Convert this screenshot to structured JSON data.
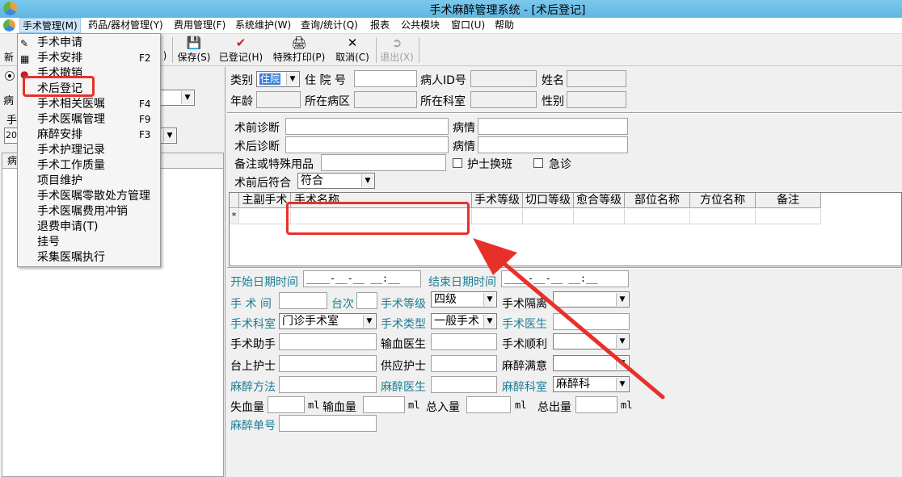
{
  "window": {
    "title": "手术麻醉管理系统 - [术后登记]"
  },
  "menubar": [
    {
      "label": "手术管理(M)"
    },
    {
      "label": "药品/器材管理(Y)"
    },
    {
      "label": "费用管理(F)"
    },
    {
      "label": "系统维护(W)"
    },
    {
      "label": "查询/统计(Q)"
    },
    {
      "label": "报表"
    },
    {
      "label": "公共模块"
    },
    {
      "label": "窗口(U)"
    },
    {
      "label": "帮助"
    }
  ],
  "toolbar": {
    "new_label": "新",
    "partial_label": ")",
    "save_label": "保存(S)",
    "registered_label": "已登记(H)",
    "special_print_label": "特殊打印(P)",
    "cancel_label": "取消(C)",
    "exit_label": "退出(X)"
  },
  "dropdown": [
    {
      "label": "手术申请",
      "shortcut": ""
    },
    {
      "label": "手术安排",
      "shortcut": "F2"
    },
    {
      "label": "手术撤销",
      "shortcut": ""
    },
    {
      "label": "术后登记",
      "shortcut": ""
    },
    {
      "label": "手术相关医嘱",
      "shortcut": "F4"
    },
    {
      "label": "手术医嘱管理",
      "shortcut": "F9"
    },
    {
      "label": "麻醉安排",
      "shortcut": "F3"
    },
    {
      "label": "手术护理记录",
      "shortcut": ""
    },
    {
      "label": "手术工作质量",
      "shortcut": ""
    },
    {
      "label": "项目维护",
      "shortcut": ""
    },
    {
      "label": "手术医嘱零散处方管理",
      "shortcut": ""
    },
    {
      "label": "手术医嘱费用冲销",
      "shortcut": ""
    },
    {
      "label": "退费申请(T)",
      "shortcut": ""
    },
    {
      "label": "挂号",
      "shortcut": ""
    },
    {
      "label": "采集医嘱执行",
      "shortcut": ""
    }
  ],
  "left": {
    "bing_label": "病",
    "shou_label": "手",
    "year_partial": "20",
    "list_header": "病"
  },
  "patient": {
    "category_label": "类别",
    "category_value": "住院",
    "inpatient_no_label": "住 院 号",
    "patient_id_label": "病人ID号",
    "name_label": "姓名",
    "age_label": "年龄",
    "ward_label": "所在病区",
    "dept_label": "所在科室",
    "gender_label": "性别"
  },
  "diagnosis": {
    "pre_diag_label": "术前诊断",
    "post_diag_label": "术后诊断",
    "condition_label": "病情",
    "remarks_label": "备注或特殊用品",
    "nurse_shift_label": "护士换班",
    "emergency_label": "急诊",
    "consistency_label": "术前后符合",
    "consistency_value": "符合"
  },
  "grid": {
    "headers": [
      "主副手术",
      "手术名称",
      "手术等级",
      "切口等级",
      "愈合等级",
      "部位名称",
      "方位名称",
      "备注"
    ],
    "new_row_marker": "*"
  },
  "details": {
    "start_time_label": "开始日期时间",
    "start_time_value": "____-__-__ __:__",
    "end_time_label": "结束日期时间",
    "end_time_value": "____-__-__ __:__",
    "room_label": "手 术 间",
    "order_label": "台次",
    "level_label": "手术等级",
    "level_value": "四级",
    "isolation_label": "手术隔离",
    "surgery_dept_label": "手术科室",
    "surgery_dept_value": "门诊手术室",
    "surgery_type_label": "手术类型",
    "surgery_type_value": "一般手术",
    "surgeon_label": "手术医生",
    "assistant_label": "手术助手",
    "transfusion_doctor_label": "输血医生",
    "smooth_label": "手术顺利",
    "scrub_nurse_label": "台上护士",
    "supply_nurse_label": "供应护士",
    "anesthesia_satisfaction_label": "麻醉满意",
    "anesthesia_method_label": "麻醉方法",
    "anesthesiologist_label": "麻醉医生",
    "anesthesia_dept_label": "麻醉科室",
    "anesthesia_dept_value": "麻醉科",
    "blood_loss_label": "失血量",
    "transfusion_volume_label": "输血量",
    "total_input_label": "总入量",
    "total_output_label": "总出量",
    "unit_ml": "ml",
    "anesthesia_no_label": "麻醉单号"
  },
  "colors": {
    "teal_label": "#1c7d94",
    "annotation_red": "#e8302a",
    "title_bar": "#6ec0ea"
  }
}
